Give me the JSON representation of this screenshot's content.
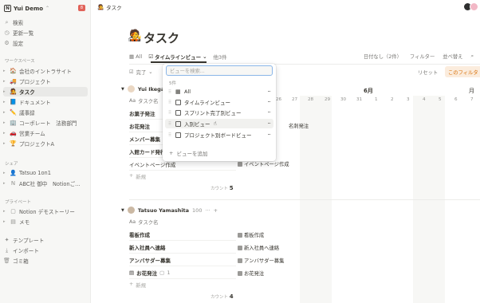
{
  "sidebar": {
    "workspace": "Yui Demo",
    "badge": "8",
    "top_items": [
      {
        "icon": "search-icon",
        "glyph": "⌕",
        "label": "検索"
      },
      {
        "icon": "clock-icon",
        "glyph": "◷",
        "label": "更新一覧"
      },
      {
        "icon": "gear-icon",
        "glyph": "⚙",
        "label": "設定"
      }
    ],
    "workspace_header": "ワークスペース",
    "pages": [
      {
        "icon": "house-icon",
        "glyph": "🏠",
        "label": "会社のイントラサイト"
      },
      {
        "icon": "truck-icon",
        "glyph": "🚚",
        "label": "プロジェクト"
      },
      {
        "icon": "task-icon",
        "glyph": "🧑‍🎤",
        "label": "タスク"
      },
      {
        "icon": "book-icon",
        "glyph": "📘",
        "label": "ドキュメント"
      },
      {
        "icon": "pencil-icon",
        "glyph": "✏️",
        "label": "議事録"
      },
      {
        "icon": "building-icon",
        "glyph": "🏢",
        "label": "コーポレート　法務部門"
      },
      {
        "icon": "car-icon",
        "glyph": "🚗",
        "label": "営業チーム"
      },
      {
        "icon": "trophy-icon",
        "glyph": "🏆",
        "label": "プロジェクトA"
      }
    ],
    "shared_header": "シェア",
    "shared": [
      {
        "icon": "avatar-icon",
        "glyph": "👤",
        "label": "Tatsuo 1on1"
      },
      {
        "icon": "notion-icon",
        "glyph": "N",
        "label": "ABC社 御中　Notionご..."
      }
    ],
    "private_header": "プライベート",
    "private": [
      {
        "icon": "notion-icon",
        "glyph": "▢",
        "label": "Notion デモストーリー"
      },
      {
        "icon": "doc-icon",
        "glyph": "▤",
        "label": "メモ"
      }
    ],
    "bottom": [
      {
        "icon": "template-icon",
        "glyph": "✦",
        "label": "テンプレート"
      },
      {
        "icon": "import-icon",
        "glyph": "⤓",
        "label": "インポート"
      },
      {
        "icon": "trash-icon",
        "glyph": "🗑",
        "label": "ゴミ箱"
      }
    ]
  },
  "header": {
    "breadcrumb": "タスク"
  },
  "page": {
    "title": "タスク"
  },
  "tabs": {
    "all": "All",
    "timeline": "タイムラインビュー",
    "more": "他3件"
  },
  "toolbar": {
    "date_none": "日付なし（2件）",
    "filter": "フィルター",
    "sort": "並べ替え"
  },
  "filter_row": {
    "completed": "完了",
    "reset": "リセット",
    "chip": "このフィルタ"
  },
  "timeline": {
    "month": "6月",
    "month_right": "月",
    "days": [
      "26",
      "27",
      "28",
      "29",
      "30",
      "31",
      "1",
      "2",
      "3",
      "4",
      "5",
      "6",
      "7"
    ]
  },
  "groups": [
    {
      "name": "Yui Ikegaki",
      "count": "",
      "prop": "タスク名",
      "tasks": [
        "お菓子発注",
        "お花発注",
        "メンバー募集",
        "入館カード発行",
        "イベントページ作成"
      ],
      "bars": [
        {
          "label": "名刺発注"
        },
        {
          "label": "イベントページ作成"
        }
      ],
      "new_label": "新規",
      "count_label": "カウント",
      "count_value": "5"
    },
    {
      "name": "Tatsuo Yamashita",
      "count": "100",
      "prop": "タスク名",
      "tasks": [
        "看板作成",
        "新入社員へ連絡",
        "アンバサダー募集",
        "お花発注"
      ],
      "comment": "1",
      "bars": [
        {
          "label": "看板作成"
        },
        {
          "label": "新入社員へ連絡"
        },
        {
          "label": "アンバサダー募集"
        },
        {
          "label": "お花発注"
        }
      ],
      "new_label": "新規",
      "count_label": "カウント",
      "count_value": "4"
    }
  ],
  "popup": {
    "placeholder": "ビューを検索...",
    "count": "5件",
    "views": [
      "All",
      "タイムラインビュー",
      "スプリント完了別ビュー",
      "入別ビュー",
      "プロジェクト別ボードビュー"
    ],
    "add": "ビューを追加"
  }
}
